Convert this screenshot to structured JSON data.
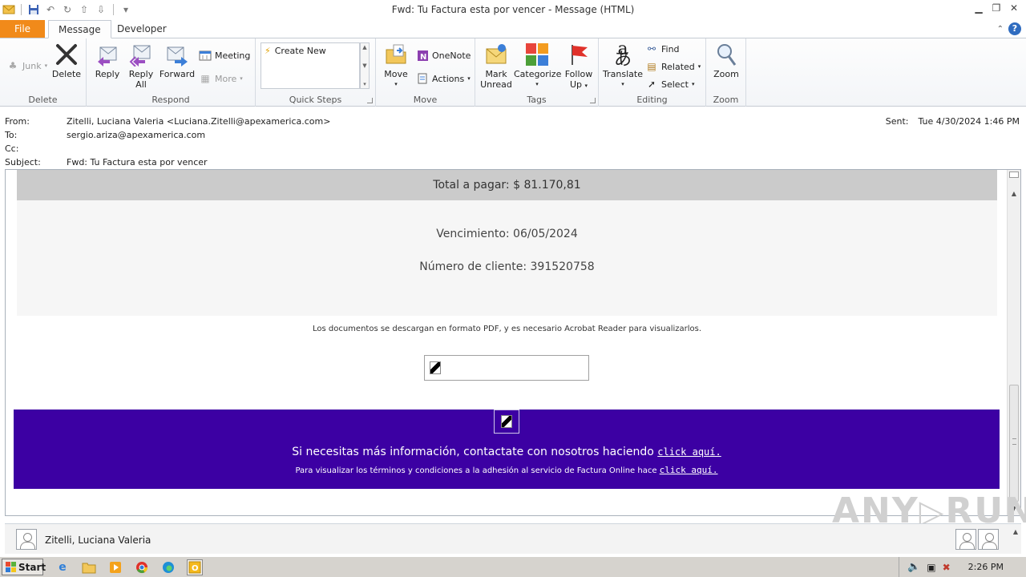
{
  "window": {
    "title": "Fwd: Tu Factura esta por vencer  -  Message (HTML)"
  },
  "tabs": {
    "file": "File",
    "message": "Message",
    "developer": "Developer"
  },
  "ribbon": {
    "delete_group": {
      "label": "Delete",
      "junk": "Junk",
      "delete": "Delete"
    },
    "respond_group": {
      "label": "Respond",
      "reply": "Reply",
      "reply_all_1": "Reply",
      "reply_all_2": "All",
      "forward": "Forward",
      "meeting": "Meeting",
      "more": "More"
    },
    "quicksteps_group": {
      "label": "Quick Steps",
      "create_new": "Create New"
    },
    "move_group": {
      "label": "Move",
      "move": "Move",
      "onenote": "OneNote",
      "actions": "Actions"
    },
    "tags_group": {
      "label": "Tags",
      "mark_unread_1": "Mark",
      "mark_unread_2": "Unread",
      "categorize": "Categorize",
      "follow_up_1": "Follow",
      "follow_up_2": "Up"
    },
    "editing_group": {
      "label": "Editing",
      "translate": "Translate",
      "find": "Find",
      "related": "Related",
      "select": "Select"
    },
    "zoom_group": {
      "label": "Zoom",
      "zoom": "Zoom"
    }
  },
  "header": {
    "from_label": "From:",
    "from_value": "Zitelli, Luciana Valeria <Luciana.Zitelli@apexamerica.com>",
    "to_label": "To:",
    "to_value": "sergio.ariza@apexamerica.com",
    "cc_label": "Cc:",
    "cc_value": "",
    "subject_label": "Subject:",
    "subject_value": "Fwd: Tu Factura esta por vencer",
    "sent_label": "Sent:",
    "sent_value": "Tue 4/30/2024 1:46 PM"
  },
  "body": {
    "total": "Total a pagar:  $ 81.170,81",
    "vencimiento": "Vencimiento: 06/05/2024",
    "cliente": "Número de cliente: 391520758",
    "docs_note": "Los documentos se descargan en formato PDF, y es necesario Acrobat Reader para visualizarlos.",
    "footer_line1": "Si necesitas más información, contactate con nosotros haciendo ",
    "footer_link1": "click aquí.",
    "footer_line2": "Para visualizar los términos y condiciones a la adhesión al servicio de Factura Online hace ",
    "footer_link2": "click aquí.",
    "footer_color": "#3c00a3"
  },
  "people_pane": {
    "name": "Zitelli, Luciana Valeria"
  },
  "taskbar": {
    "start": "Start",
    "clock": "2:26 PM"
  },
  "watermark": "ANY▷RUN"
}
